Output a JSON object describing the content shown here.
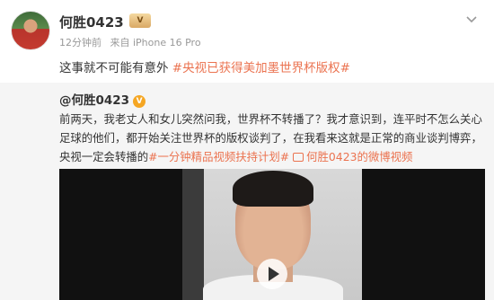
{
  "post": {
    "author": "何胜0423",
    "vip_badge": "V",
    "time": "12分钟前",
    "source": "来自 iPhone 16 Pro",
    "text_plain": "这事就不可能有意外",
    "topic": "#央视已获得美加墨世界杯版权#"
  },
  "repost": {
    "author": "@何胜0423",
    "badge": "V",
    "line1": "前两天，我老丈人和女儿突然问我，世界杯不转播了？我才意识到，连平时不怎么关心",
    "line2": "足球的他们，都开始关注世界杯的版权谈判了，在我看来这就是正常的商业谈判博弈，",
    "line3_plain": "央视一定会转播的",
    "line3_topic": "#一分钟精品视频扶持计划#",
    "line3_link": "何胜0423的微博视频"
  },
  "icons": {
    "more": "chevron-down-icon",
    "video_link": "video-link-icon",
    "play": "play-icon"
  },
  "colors": {
    "topic": "#eb7350",
    "repost_bg": "#f5f5f5",
    "meta": "#999999"
  }
}
